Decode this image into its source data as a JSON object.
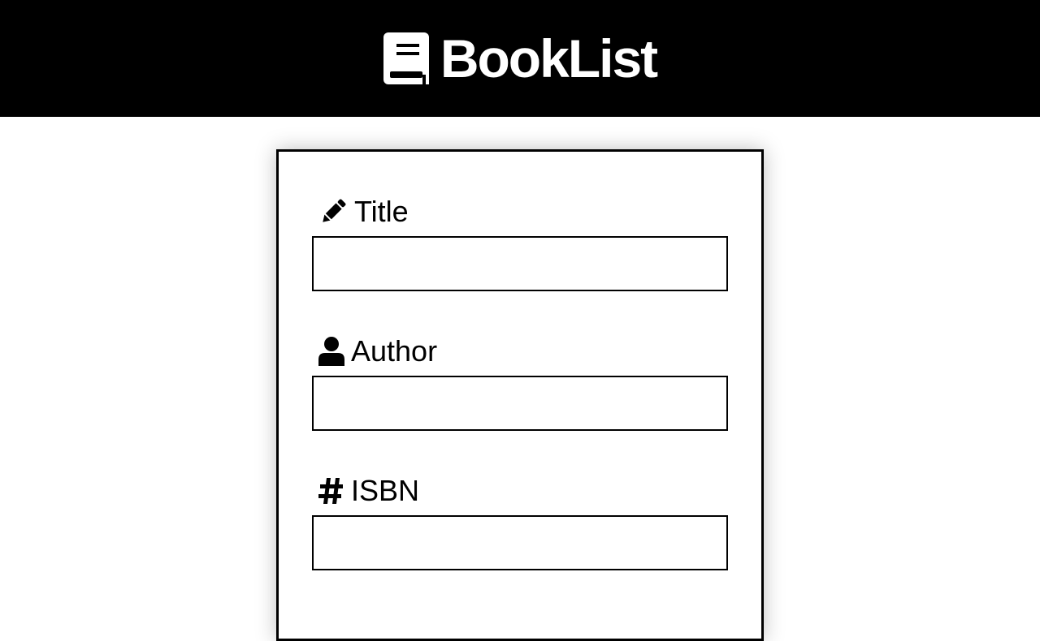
{
  "app": {
    "name": "BookList",
    "logo_icon": "book-icon"
  },
  "form": {
    "fields": [
      {
        "label": "Title",
        "icon": "pencil-icon",
        "value": "",
        "placeholder": ""
      },
      {
        "label": "Author",
        "icon": "user-icon",
        "value": "",
        "placeholder": ""
      },
      {
        "label": "ISBN",
        "icon": "hash-icon",
        "value": "",
        "placeholder": ""
      }
    ]
  },
  "colors": {
    "header_bg": "#000000",
    "header_text": "#ffffff",
    "page_bg": "#ffffff",
    "border": "#000000"
  }
}
